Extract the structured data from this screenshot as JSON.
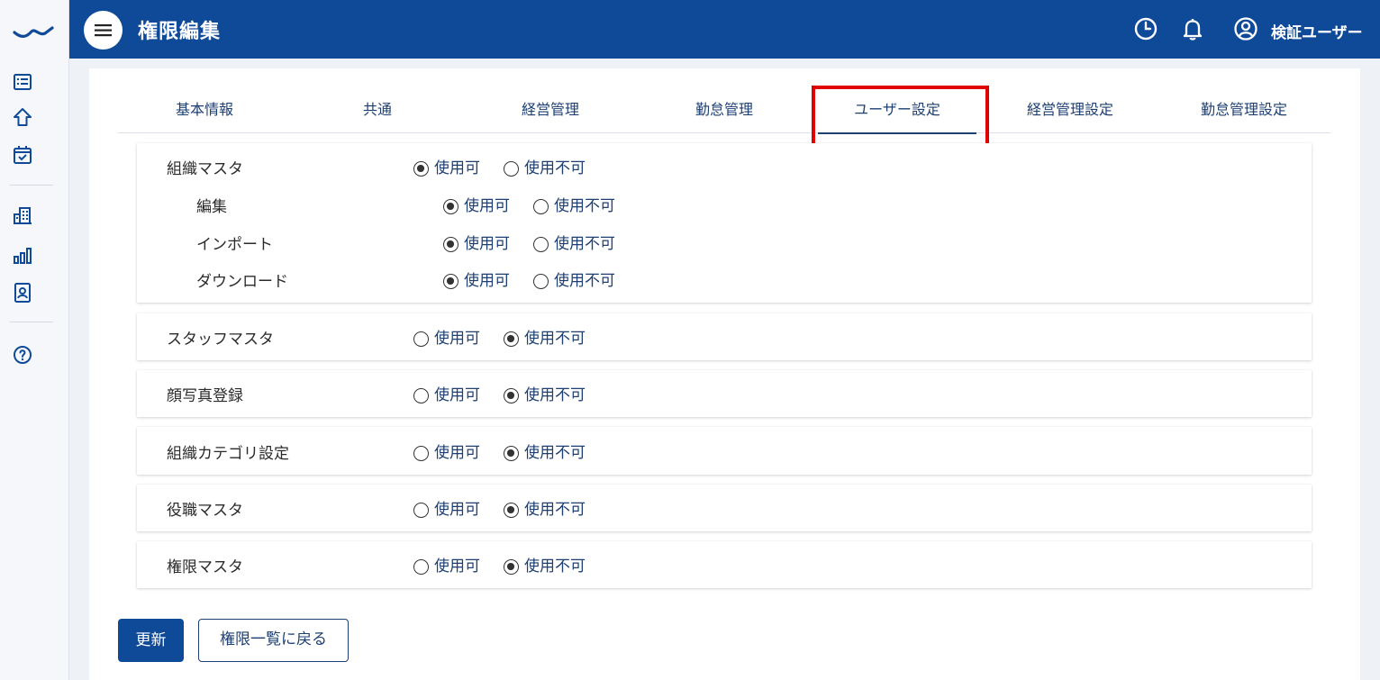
{
  "header": {
    "title": "権限編集",
    "user_name": "検証ユーザー"
  },
  "tabs": [
    {
      "label": "基本情報"
    },
    {
      "label": "共通"
    },
    {
      "label": "経営管理"
    },
    {
      "label": "勤怠管理"
    },
    {
      "label": "ユーザー設定"
    },
    {
      "label": "経営管理設定"
    },
    {
      "label": "勤怠管理設定"
    }
  ],
  "active_tab": "ユーザー設定",
  "options": {
    "allow": "使用可",
    "deny": "使用不可"
  },
  "permissions": {
    "org_master": {
      "label": "組織マスタ",
      "value": "使用可"
    },
    "edit": {
      "label": "編集",
      "value": "使用可"
    },
    "import": {
      "label": "インポート",
      "value": "使用可"
    },
    "download": {
      "label": "ダウンロード",
      "value": "使用可"
    },
    "staff_master": {
      "label": "スタッフマスタ",
      "value": "使用不可"
    },
    "face_photo": {
      "label": "顔写真登録",
      "value": "使用不可"
    },
    "org_category": {
      "label": "組織カテゴリ設定",
      "value": "使用不可"
    },
    "position_master": {
      "label": "役職マスタ",
      "value": "使用不可"
    },
    "role_master": {
      "label": "権限マスタ",
      "value": "使用不可"
    }
  },
  "buttons": {
    "update": "更新",
    "back": "権限一覧に戻る"
  },
  "colors": {
    "primary": "#0f4a99",
    "highlight": "#e00000"
  },
  "sidebar_icons": [
    "logo",
    "list-icon",
    "home-icon",
    "calendar-check-icon",
    "building-icon",
    "bar-chart-icon",
    "id-card-icon",
    "help-icon"
  ]
}
